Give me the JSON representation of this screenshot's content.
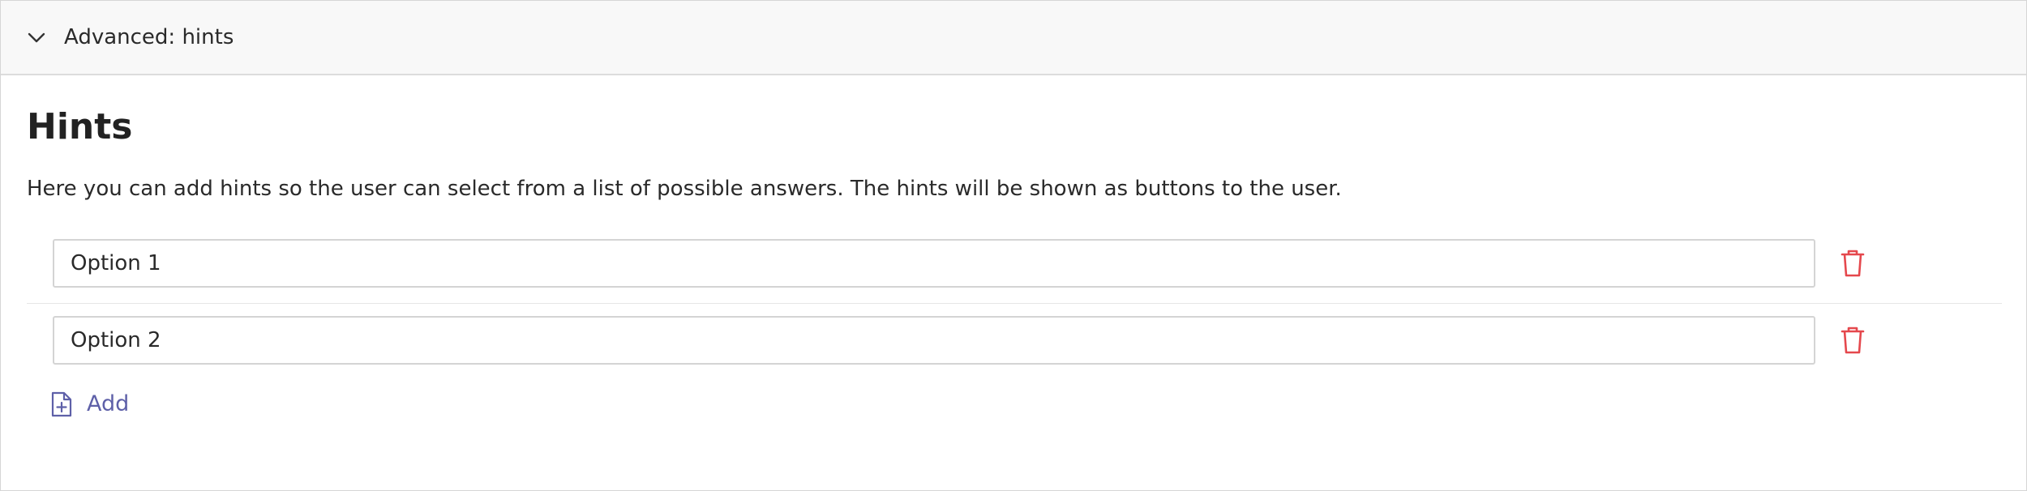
{
  "header": {
    "title": "Advanced: hints",
    "toggle_icon": "chevron-down-icon"
  },
  "section": {
    "title": "Hints",
    "description": "Here you can add hints so the user can select from a list of possible answers. The hints will be shown as buttons to the user."
  },
  "hints": [
    {
      "value": "Option 1",
      "delete_icon": "trash-icon"
    },
    {
      "value": "Option 2",
      "delete_icon": "trash-icon"
    }
  ],
  "add_button": {
    "label": "Add",
    "icon": "file-plus-icon"
  },
  "colors": {
    "accent": "#5e60a8",
    "danger": "#e5484d",
    "header_bg": "#f8f8f8",
    "border": "#d4d4d4"
  }
}
